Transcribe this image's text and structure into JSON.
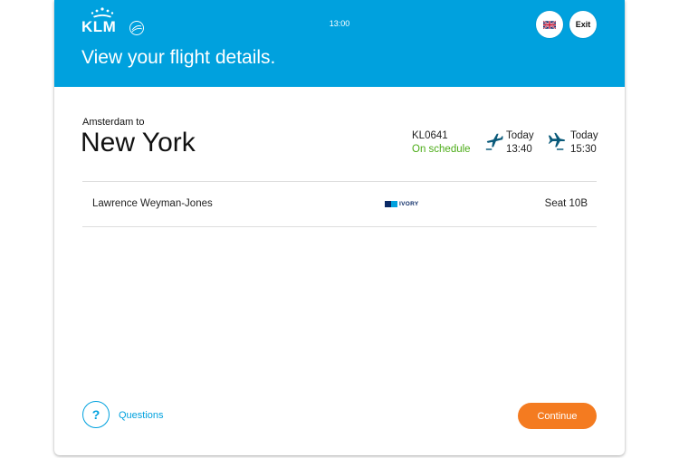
{
  "header": {
    "brand": "KLM",
    "clock": "13:00",
    "title": "View your flight details.",
    "exit_label": "Exit",
    "language_flag": "uk-flag-icon",
    "color": "#00a1de"
  },
  "flight": {
    "origin_text": "Amsterdam to",
    "destination": "New York",
    "number": "KL0641",
    "status": "On schedule",
    "status_color": "#4cac18",
    "departure": {
      "day": "Today",
      "time": "13:40",
      "icon": "departure-plane-icon"
    },
    "arrival": {
      "day": "Today",
      "time": "15:30",
      "icon": "arrival-plane-icon"
    }
  },
  "passenger": {
    "name": "Lawrence Weyman-Jones",
    "tier": "IVORY",
    "seat": "Seat 10B"
  },
  "footer": {
    "help_symbol": "?",
    "help_label": "Questions",
    "continue_label": "Continue",
    "continue_color": "#f47b20"
  }
}
